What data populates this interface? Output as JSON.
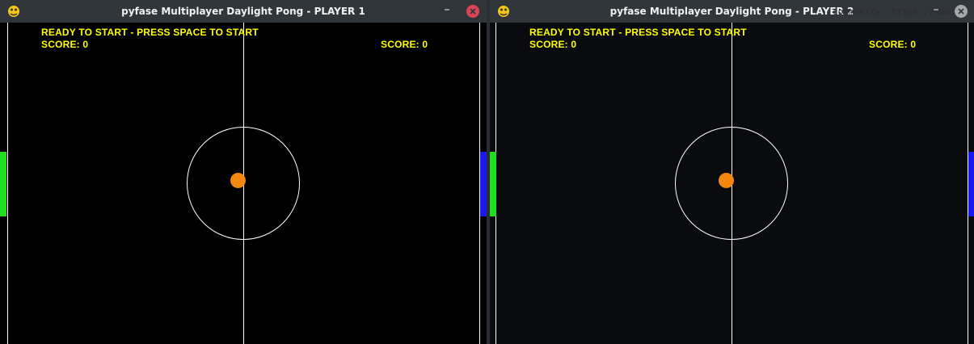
{
  "windows": [
    {
      "title": "pyfase Multiplayer Daylight Pong - PLAYER 1",
      "status": "READY TO START - PRESS SPACE TO START",
      "score_left_label": "SCORE:",
      "score_left_value": "0",
      "score_right_label": "SCORE:",
      "score_right_value": "0",
      "minimize_glyph": "–",
      "close_glyph": "×"
    },
    {
      "title": "pyfase Multiplayer Daylight Pong - PLAYER 2",
      "status": "READY TO START - PRESS SPACE TO START",
      "score_left_label": "SCORE:",
      "score_left_value": "0",
      "score_right_label": "SCORE:",
      "score_right_value": "0",
      "minimize_glyph": "–",
      "close_glyph": "×",
      "background_text": "community. https://www."
    }
  ],
  "colors": {
    "hud_text": "#ffff00",
    "ball": "#f4880f",
    "left_paddle": "#22dd22",
    "right_paddle": "#1a1aee",
    "close_active": "#da4453",
    "close_inactive": "#a5a7aa"
  },
  "icons": {
    "app": "pygame-snake-icon",
    "minimize": "minimize-icon",
    "close": "close-icon"
  }
}
